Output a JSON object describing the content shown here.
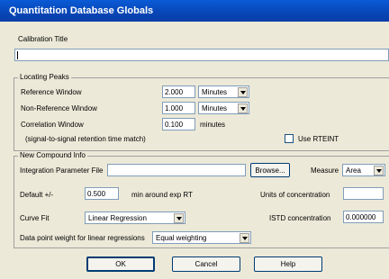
{
  "window": {
    "title": "Quantitation Database Globals"
  },
  "calibration": {
    "label": "Calibration Title",
    "value": ""
  },
  "locating": {
    "group_title": "Locating Peaks",
    "ref_label": "Reference Window",
    "ref_value": "2.000",
    "ref_unit": "Minutes",
    "nonref_label": "Non-Reference Window",
    "nonref_value": "1.000",
    "nonref_unit": "Minutes",
    "corr_label": "Correlation Window",
    "corr_value": "0.100",
    "corr_unit": "minutes",
    "corr_note": "(signal-to-signal retention time match)",
    "rteint_label": "Use RTEINT",
    "rteint_checked": false
  },
  "compound": {
    "group_title": "New Compound Info",
    "ipf_label": "Integration Parameter File",
    "ipf_value": "",
    "browse_label": "Browse...",
    "measure_label": "Measure",
    "measure_value": "Area",
    "default_label": "Default +/-",
    "default_value": "0.500",
    "default_note": "min around exp RT",
    "units_label": "Units of concentration",
    "units_value": "",
    "curve_label": "Curve Fit",
    "curve_value": "Linear Regression",
    "istd_label": "ISTD concentration",
    "istd_value": "0.000000",
    "weight_label": "Data point weight for linear regressions",
    "weight_value": "Equal weighting"
  },
  "buttons": {
    "ok": "OK",
    "cancel": "Cancel",
    "help": "Help"
  },
  "colors": {
    "titlebar": "#0a5ad6",
    "dialog": "#ece9d8"
  }
}
